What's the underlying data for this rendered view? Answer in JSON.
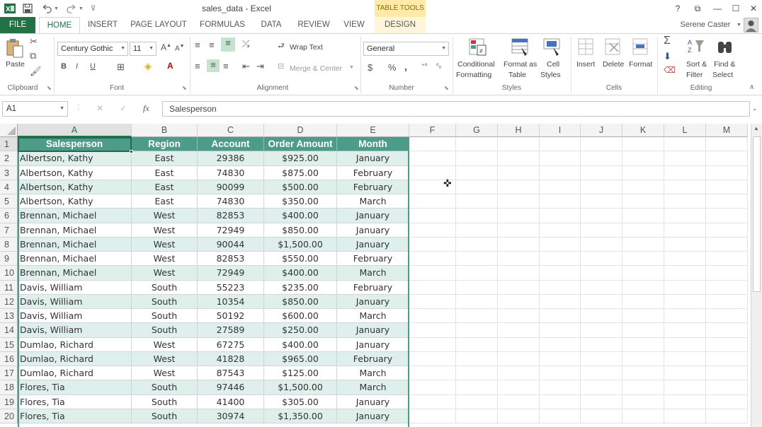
{
  "titlebar": {
    "title": "sales_data - Excel",
    "table_tools": "TABLE TOOLS",
    "help": "?",
    "restore": "⧉",
    "minimize": "—",
    "maximize": "☐",
    "close": "✕"
  },
  "tabs": {
    "file": "FILE",
    "home": "HOME",
    "insert": "INSERT",
    "page_layout": "PAGE LAYOUT",
    "formulas": "FORMULAS",
    "data": "DATA",
    "review": "REVIEW",
    "view": "VIEW",
    "design": "DESIGN",
    "user": "Serene Caster"
  },
  "ribbon": {
    "clipboard": {
      "label": "Clipboard",
      "paste": "Paste"
    },
    "font": {
      "label": "Font",
      "name": "Century Gothic",
      "size": "11",
      "bold": "B",
      "italic": "I",
      "underline": "U"
    },
    "alignment": {
      "label": "Alignment",
      "wrap": "Wrap Text",
      "merge": "Merge & Center"
    },
    "number": {
      "label": "Number",
      "format": "General",
      "currency": "$",
      "percent": "%",
      "comma": ","
    },
    "styles": {
      "label": "Styles",
      "conditional_1": "Conditional",
      "conditional_2": "Formatting",
      "format_table_1": "Format as",
      "format_table_2": "Table",
      "cell_styles_1": "Cell",
      "cell_styles_2": "Styles"
    },
    "cells": {
      "label": "Cells",
      "insert": "Insert",
      "delete": "Delete",
      "format": "Format"
    },
    "editing": {
      "label": "Editing",
      "sort_1": "Sort &",
      "sort_2": "Filter",
      "find_1": "Find &",
      "find_2": "Select"
    }
  },
  "formula_bar": {
    "name_box": "A1",
    "fx": "fx",
    "content": "Salesperson"
  },
  "colors": {
    "accent": "#217346",
    "table_header": "#4d9b89",
    "table_band": "#dfefeb"
  },
  "columns": [
    "A",
    "B",
    "C",
    "D",
    "E",
    "F",
    "G",
    "H",
    "I",
    "J",
    "K",
    "L",
    "M"
  ],
  "rows": [
    "1",
    "2",
    "3",
    "4",
    "5",
    "6",
    "7",
    "8",
    "9",
    "10",
    "11",
    "12",
    "13",
    "14",
    "15",
    "16",
    "17",
    "18",
    "19",
    "20"
  ],
  "table": {
    "headers": [
      "Salesperson",
      "Region",
      "Account",
      "Order Amount",
      "Month"
    ],
    "data": [
      [
        "Albertson, Kathy",
        "East",
        "29386",
        "$925.00",
        "January"
      ],
      [
        "Albertson, Kathy",
        "East",
        "74830",
        "$875.00",
        "February"
      ],
      [
        "Albertson, Kathy",
        "East",
        "90099",
        "$500.00",
        "February"
      ],
      [
        "Albertson, Kathy",
        "East",
        "74830",
        "$350.00",
        "March"
      ],
      [
        "Brennan, Michael",
        "West",
        "82853",
        "$400.00",
        "January"
      ],
      [
        "Brennan, Michael",
        "West",
        "72949",
        "$850.00",
        "January"
      ],
      [
        "Brennan, Michael",
        "West",
        "90044",
        "$1,500.00",
        "January"
      ],
      [
        "Brennan, Michael",
        "West",
        "82853",
        "$550.00",
        "February"
      ],
      [
        "Brennan, Michael",
        "West",
        "72949",
        "$400.00",
        "March"
      ],
      [
        "Davis, William",
        "South",
        "55223",
        "$235.00",
        "February"
      ],
      [
        "Davis, William",
        "South",
        "10354",
        "$850.00",
        "January"
      ],
      [
        "Davis, William",
        "South",
        "50192",
        "$600.00",
        "March"
      ],
      [
        "Davis, William",
        "South",
        "27589",
        "$250.00",
        "January"
      ],
      [
        "Dumlao, Richard",
        "West",
        "67275",
        "$400.00",
        "January"
      ],
      [
        "Dumlao, Richard",
        "West",
        "41828",
        "$965.00",
        "February"
      ],
      [
        "Dumlao, Richard",
        "West",
        "87543",
        "$125.00",
        "March"
      ],
      [
        "Flores, Tia",
        "South",
        "97446",
        "$1,500.00",
        "March"
      ],
      [
        "Flores, Tia",
        "South",
        "41400",
        "$305.00",
        "January"
      ],
      [
        "Flores, Tia",
        "South",
        "30974",
        "$1,350.00",
        "January"
      ]
    ]
  }
}
